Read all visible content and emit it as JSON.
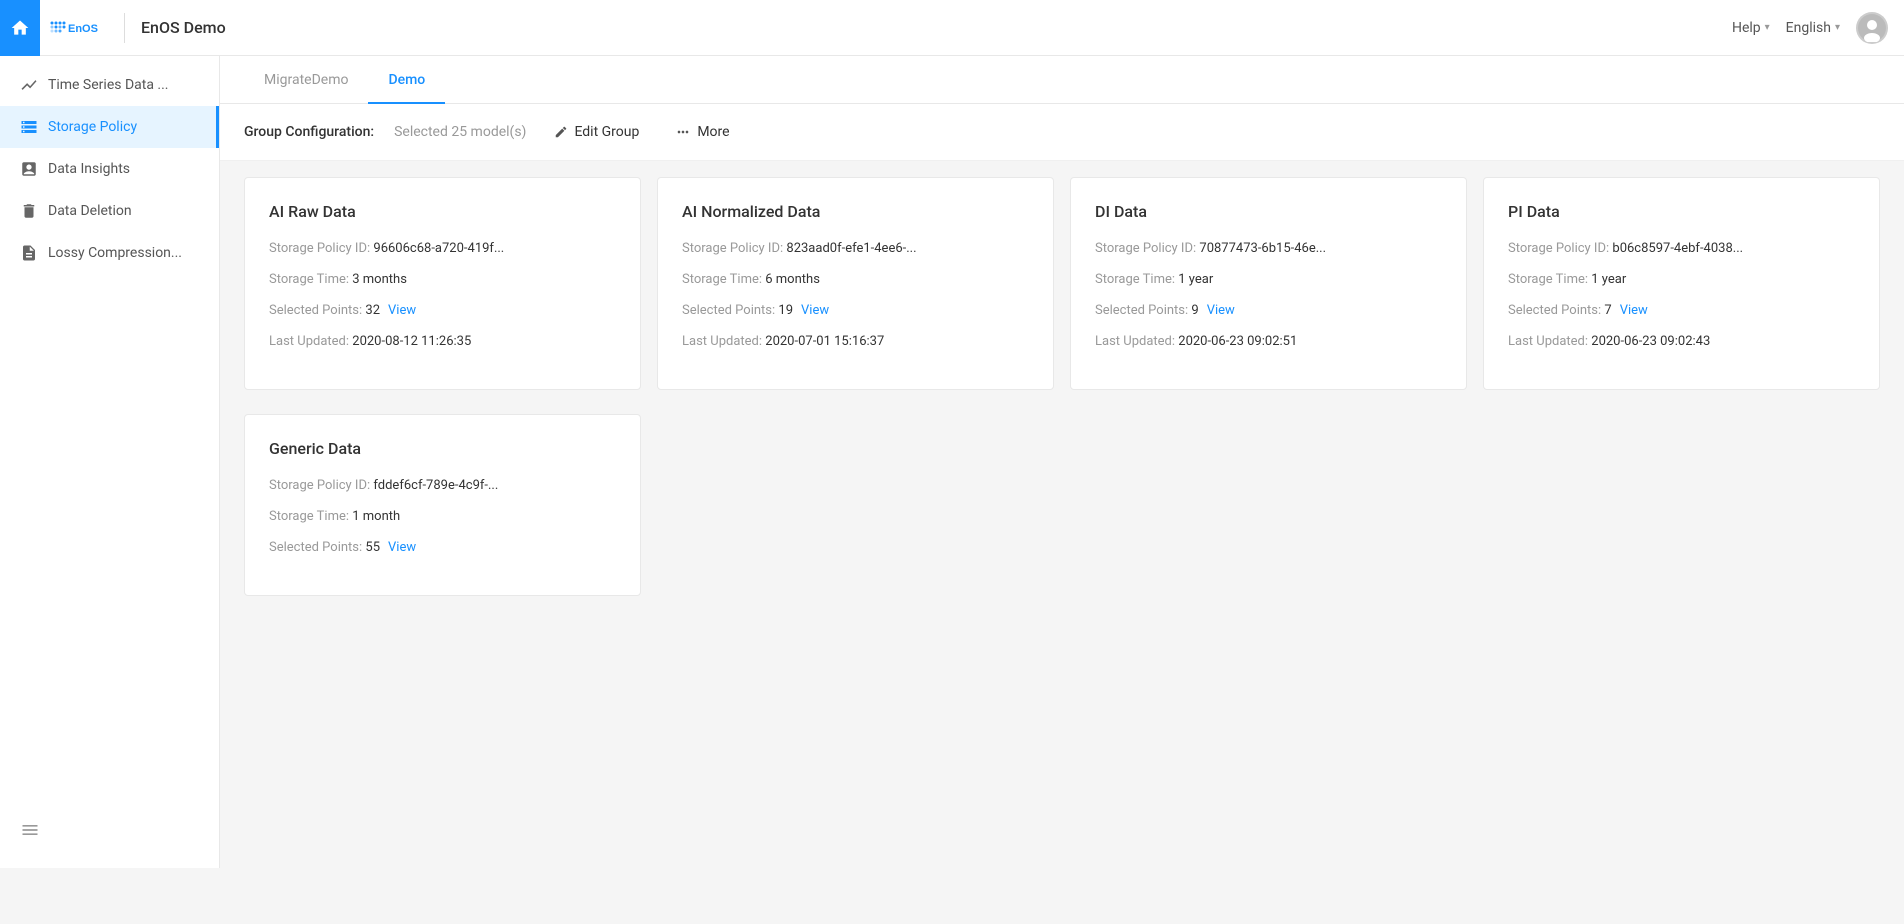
{
  "header": {
    "app_name": "EnOS Demo",
    "help_label": "Help",
    "lang_label": "English",
    "logo_text": "EnOS"
  },
  "sidebar": {
    "items": [
      {
        "id": "time-series",
        "label": "Time Series Data ...",
        "icon": "chart-icon",
        "active": false
      },
      {
        "id": "storage-policy",
        "label": "Storage Policy",
        "icon": "storage-icon",
        "active": true
      },
      {
        "id": "data-insights",
        "label": "Data Insights",
        "icon": "insights-icon",
        "active": false
      },
      {
        "id": "data-deletion",
        "label": "Data Deletion",
        "icon": "deletion-icon",
        "active": false
      },
      {
        "id": "lossy-compression",
        "label": "Lossy Compression...",
        "icon": "compression-icon",
        "active": false
      }
    ]
  },
  "tabs": [
    {
      "id": "migrate-demo",
      "label": "MigrateDemo",
      "active": false
    },
    {
      "id": "demo",
      "label": "Demo",
      "active": true
    }
  ],
  "group_config": {
    "label": "Group Configuration:",
    "value": "Selected 25 model(s)",
    "edit_group_label": "Edit Group",
    "more_label": "More"
  },
  "cards": [
    {
      "id": "ai-raw",
      "title": "AI Raw Data",
      "policy_id_label": "Storage Policy ID:",
      "policy_id_value": "96606c68-a720-419f...",
      "storage_time_label": "Storage Time:",
      "storage_time_value": "3 months",
      "selected_points_label": "Selected Points:",
      "selected_points_value": "32",
      "view_label": "View",
      "last_updated_label": "Last Updated:",
      "last_updated_value": "2020-08-12 11:26:35"
    },
    {
      "id": "ai-normalized",
      "title": "AI Normalized Data",
      "policy_id_label": "Storage Policy ID:",
      "policy_id_value": "823aad0f-efe1-4ee6-...",
      "storage_time_label": "Storage Time:",
      "storage_time_value": "6 months",
      "selected_points_label": "Selected Points:",
      "selected_points_value": "19",
      "view_label": "View",
      "last_updated_label": "Last Updated:",
      "last_updated_value": "2020-07-01 15:16:37"
    },
    {
      "id": "di-data",
      "title": "DI Data",
      "policy_id_label": "Storage Policy ID:",
      "policy_id_value": "70877473-6b15-46e...",
      "storage_time_label": "Storage Time:",
      "storage_time_value": "1 year",
      "selected_points_label": "Selected Points:",
      "selected_points_value": "9",
      "view_label": "View",
      "last_updated_label": "Last Updated:",
      "last_updated_value": "2020-06-23 09:02:51"
    },
    {
      "id": "pi-data",
      "title": "PI Data",
      "policy_id_label": "Storage Policy ID:",
      "policy_id_value": "b06c8597-4ebf-4038...",
      "storage_time_label": "Storage Time:",
      "storage_time_value": "1 year",
      "selected_points_label": "Selected Points:",
      "selected_points_value": "7",
      "view_label": "View",
      "last_updated_label": "Last Updated:",
      "last_updated_value": "2020-06-23 09:02:43"
    }
  ],
  "cards_row2": [
    {
      "id": "generic-data",
      "title": "Generic Data",
      "policy_id_label": "Storage Policy ID:",
      "policy_id_value": "fddef6cf-789e-4c9f-...",
      "storage_time_label": "Storage Time:",
      "storage_time_value": "1 month",
      "selected_points_label": "Selected Points:",
      "selected_points_value": "55",
      "view_label": "View"
    }
  ]
}
